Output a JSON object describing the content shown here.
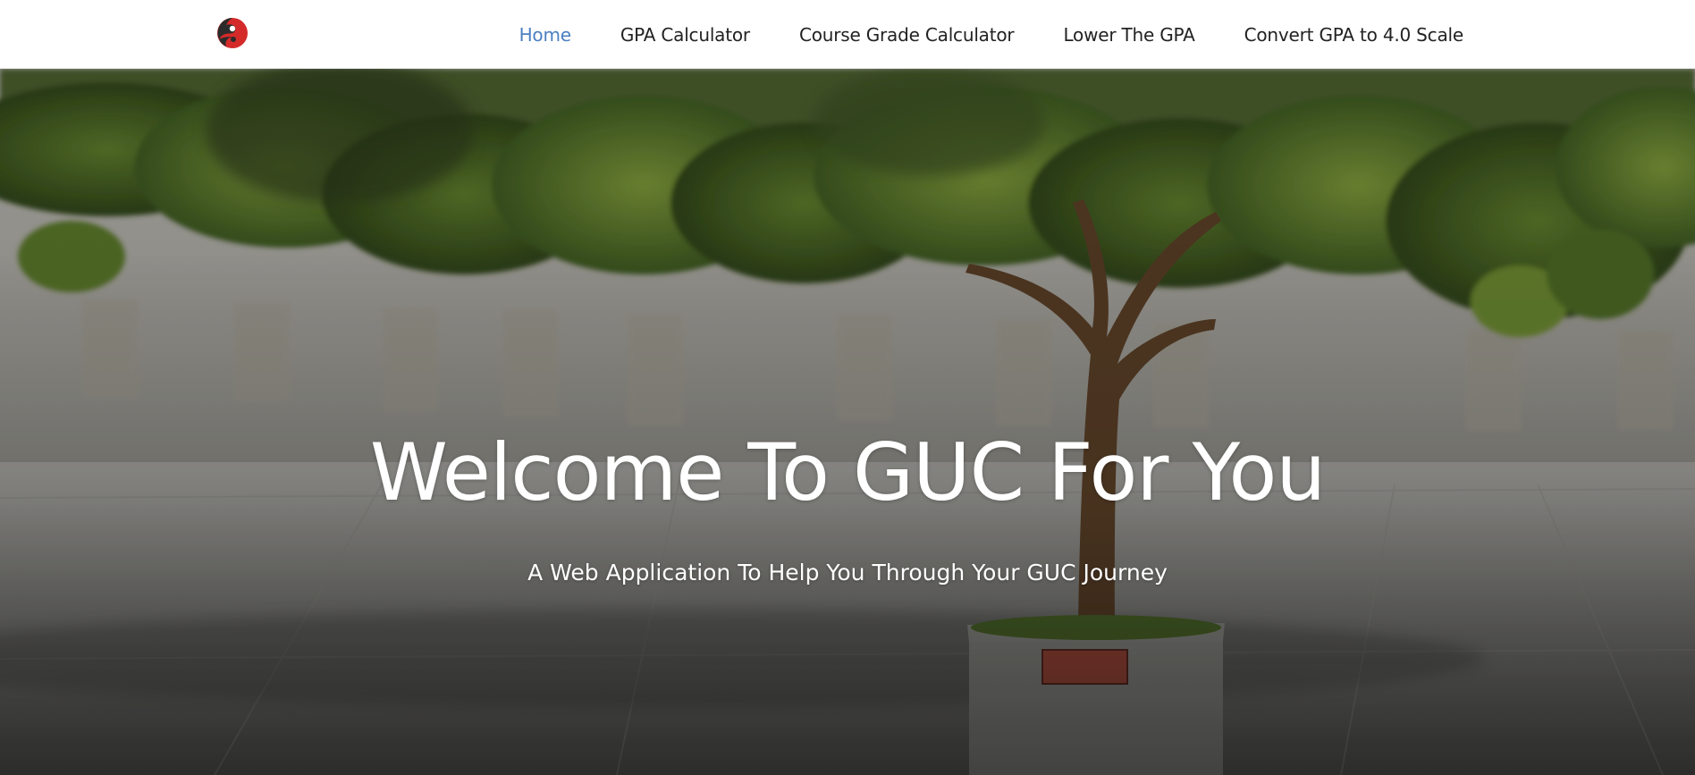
{
  "navbar": {
    "logo_icon": "guc-swirl-logo-icon",
    "links": [
      {
        "label": "Home",
        "active": true
      },
      {
        "label": "GPA Calculator",
        "active": false
      },
      {
        "label": "Course Grade Calculator",
        "active": false
      },
      {
        "label": "Lower The GPA",
        "active": false
      },
      {
        "label": "Convert GPA to 4.0 Scale",
        "active": false
      }
    ]
  },
  "hero": {
    "title": "Welcome To GUC For You",
    "subtitle": "A Web Application To Help You Through Your GUC Journey",
    "background": "courtyard-tree-photo"
  },
  "colors": {
    "active_link": "#4a7fc1",
    "link": "#222222",
    "logo_red": "#d42a2a",
    "logo_dark": "#2b2b2b",
    "hero_text": "#ffffff"
  }
}
